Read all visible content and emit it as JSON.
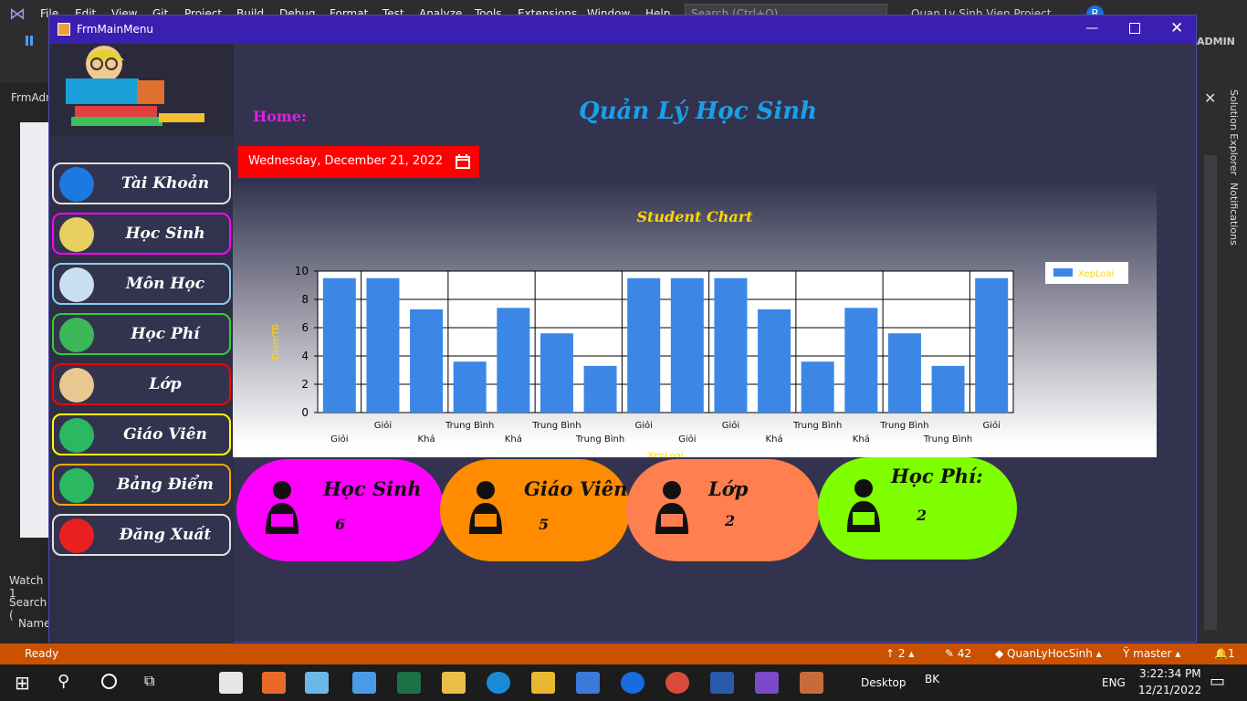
{
  "vs": {
    "menu": [
      "File",
      "Edit",
      "View",
      "Git",
      "Project",
      "Build",
      "Debug",
      "Format",
      "Test",
      "Analyze",
      "Tools",
      "Extensions",
      "Window",
      "Help"
    ],
    "search_placeholder": "Search (Ctrl+Q)",
    "solution_title": "Quan Ly Sinh Vien Project",
    "profile_initial": "R",
    "admin_badge": "ADMIN",
    "left_tab": "FrmAdn",
    "watch_label": "Watch 1",
    "search_label": "Search (",
    "name_label": "Name",
    "right_tabs": [
      "Solution Explorer",
      "Notifications"
    ],
    "status": {
      "ready": "Ready",
      "up": "2",
      "edits": "42",
      "repo": "QuanLyHocSinh",
      "branch": "master",
      "notif": "1"
    }
  },
  "taskbar": {
    "desktop": "Desktop",
    "user": "BK",
    "lang": "ENG",
    "time": "3:22:34 PM",
    "date": "12/21/2022"
  },
  "form": {
    "title": "FrmMainMenu",
    "home_label": "Home:",
    "main_title": "Quản Lý Học Sinh",
    "date_value": "Wednesday, December 21, 2022",
    "nav": [
      {
        "label": "Tài Khoản",
        "color": "#e0e0e0",
        "icon": "user-icon"
      },
      {
        "label": "Học Sinh",
        "color": "#ff00ff",
        "icon": "student-icon"
      },
      {
        "label": "Môn Học",
        "color": "#87ceeb",
        "icon": "flask-icon"
      },
      {
        "label": "Học Phí",
        "color": "#32cd32",
        "icon": "money-icon"
      },
      {
        "label": "Lớp",
        "color": "#ff0000",
        "icon": "classroom-icon"
      },
      {
        "label": "Giáo Viên",
        "color": "#ffff00",
        "icon": "teacher-icon"
      },
      {
        "label": "Bảng Điểm",
        "color": "#ffa500",
        "icon": "report-icon"
      },
      {
        "label": "Đăng Xuất",
        "color": "#e0e0e0",
        "icon": "power-icon"
      }
    ],
    "cards": [
      {
        "title": "Học Sinh",
        "value": "6",
        "color": "#ff00ff",
        "icon": "student-reading-icon"
      },
      {
        "title": "Giáo Viên",
        "value": "5",
        "color": "#ff8c00",
        "icon": "teacher-board-icon"
      },
      {
        "title": "Lớp",
        "value": "2",
        "color": "#ff7f50",
        "icon": "class-presentation-icon"
      },
      {
        "title": "Học Phí:",
        "value": "2",
        "color": "#7fff00",
        "icon": "school-building-icon"
      }
    ]
  },
  "chart_data": {
    "type": "bar",
    "title": "Student Chart",
    "xlabel": "XepLoai",
    "ylabel": "DiemTB",
    "ylim": [
      0,
      10
    ],
    "yticks": [
      0,
      2,
      4,
      6,
      8,
      10
    ],
    "grid": true,
    "legend_position": "top-right",
    "categories": [
      "Giỏi",
      "Giỏi",
      "Khá",
      "Trung Bình",
      "Khá",
      "Trung Bình",
      "Trung Bình",
      "Giỏi",
      "Giỏi",
      "Giỏi",
      "Khá",
      "Trung Bình",
      "Khá",
      "Trung Bình",
      "Trung Bình",
      "Giỏi"
    ],
    "series": [
      {
        "name": "XepLoai",
        "color": "#3c87e6",
        "values": [
          9.5,
          9.5,
          7.3,
          3.6,
          7.4,
          5.6,
          3.3,
          9.5,
          9.5,
          9.5,
          7.3,
          3.6,
          7.4,
          5.6,
          3.3,
          9.5
        ]
      }
    ],
    "title_color": "#ffd700",
    "axis_label_color": "#ffd700"
  }
}
